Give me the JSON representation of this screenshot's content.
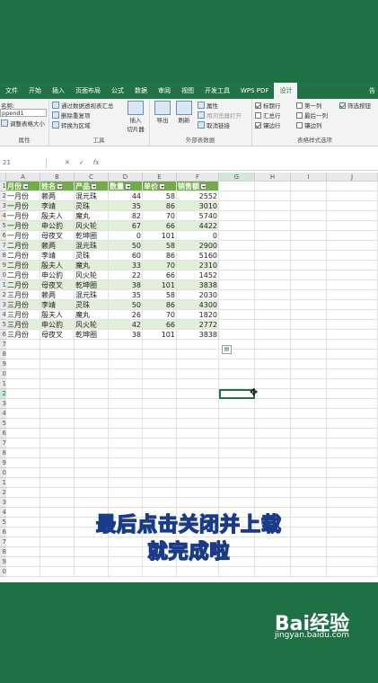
{
  "ribbon": {
    "tabs": [
      "文件",
      "开始",
      "插入",
      "页面布局",
      "公式",
      "数据",
      "审阅",
      "视图",
      "开发工具",
      "WPS PDF",
      "设计"
    ],
    "active_tab": "设计",
    "help_label": "告",
    "groups": {
      "properties": {
        "name_label": "名称:",
        "table_name": "ppend1",
        "resize_label": "调整表格大小",
        "label": "属性"
      },
      "tools": {
        "pivot": "通过数据透视表汇总",
        "remove_dup": "删除重复项",
        "convert": "转换为区域",
        "slicer_line1": "插入",
        "slicer_line2": "切片器",
        "label": "工具"
      },
      "external": {
        "export": "导出",
        "refresh": "刷新",
        "props": "属性",
        "open_browser": "用浏览器打开",
        "unlink": "取消链接",
        "label": "外部表数据"
      },
      "style_options": {
        "options": [
          {
            "label": "标题行",
            "checked": true
          },
          {
            "label": "汇总行",
            "checked": false
          },
          {
            "label": "镶边行",
            "checked": true
          },
          {
            "label": "第一列",
            "checked": false
          },
          {
            "label": "最后一列",
            "checked": false
          },
          {
            "label": "镶边列",
            "checked": false
          },
          {
            "label": "筛选按钮",
            "checked": true
          }
        ],
        "label": "表格样式选项"
      }
    }
  },
  "formula_bar": {
    "name_box": "21",
    "cancel": "✕",
    "enter": "✓",
    "fx": "fx",
    "content": ""
  },
  "sheet": {
    "columns": [
      "A",
      "B",
      "C",
      "D",
      "E",
      "F",
      "G",
      "H",
      "I",
      "J"
    ],
    "row_numbers": [
      "1",
      "2",
      "3",
      "4",
      "5",
      "6",
      "7",
      "8",
      "9",
      "0",
      "1",
      "2",
      "3",
      "4",
      "5",
      "6",
      "7",
      "8",
      "9",
      "0",
      "1",
      "2",
      "3",
      "4",
      "5",
      "6",
      "7",
      "8",
      "9",
      "0",
      "1",
      "2",
      "3",
      "4",
      "5",
      "6",
      "7",
      "8",
      "9",
      "0"
    ],
    "headers": [
      "月份",
      "姓名",
      "产品",
      "数量",
      "单价",
      "销售额"
    ],
    "rows": [
      [
        "一月份",
        "赖两",
        "混元珠",
        "44",
        "58",
        "2552"
      ],
      [
        "一月份",
        "李靖",
        "灵珠",
        "35",
        "86",
        "3010"
      ],
      [
        "一月份",
        "殷夫人",
        "魔丸",
        "82",
        "70",
        "5740"
      ],
      [
        "一月份",
        "申公豹",
        "风火轮",
        "67",
        "66",
        "4422"
      ],
      [
        "一月份",
        "母夜叉",
        "乾坤圈",
        "0",
        "101",
        "0"
      ],
      [
        "二月份",
        "赖两",
        "混元珠",
        "50",
        "58",
        "2900"
      ],
      [
        "二月份",
        "李靖",
        "灵珠",
        "60",
        "86",
        "5160"
      ],
      [
        "二月份",
        "殷夫人",
        "魔丸",
        "33",
        "70",
        "2310"
      ],
      [
        "二月份",
        "申公豹",
        "风火轮",
        "22",
        "66",
        "1452"
      ],
      [
        "二月份",
        "母夜叉",
        "乾坤圈",
        "38",
        "101",
        "3838"
      ],
      [
        "三月份",
        "赖两",
        "混元珠",
        "35",
        "58",
        "2030"
      ],
      [
        "三月份",
        "李靖",
        "灵珠",
        "50",
        "86",
        "4300"
      ],
      [
        "三月份",
        "殷夫人",
        "魔丸",
        "26",
        "70",
        "1820"
      ],
      [
        "三月份",
        "申公豹",
        "风火轮",
        "42",
        "66",
        "2772"
      ],
      [
        "三月份",
        "母夜叉",
        "乾坤圈",
        "38",
        "101",
        "3838"
      ]
    ],
    "quick_analysis_icon": "quick-analysis-icon"
  },
  "caption": {
    "line1": "最后点击关闭并上载",
    "line2": "就完成啦"
  },
  "watermark": {
    "brand": "Bai经验",
    "url": "jingyan.baidu.com"
  },
  "colors": {
    "excel_green": "#217346",
    "header_green": "#70ad47",
    "band_green": "#e2efd9",
    "caption_yellow": "#f3e94e"
  }
}
